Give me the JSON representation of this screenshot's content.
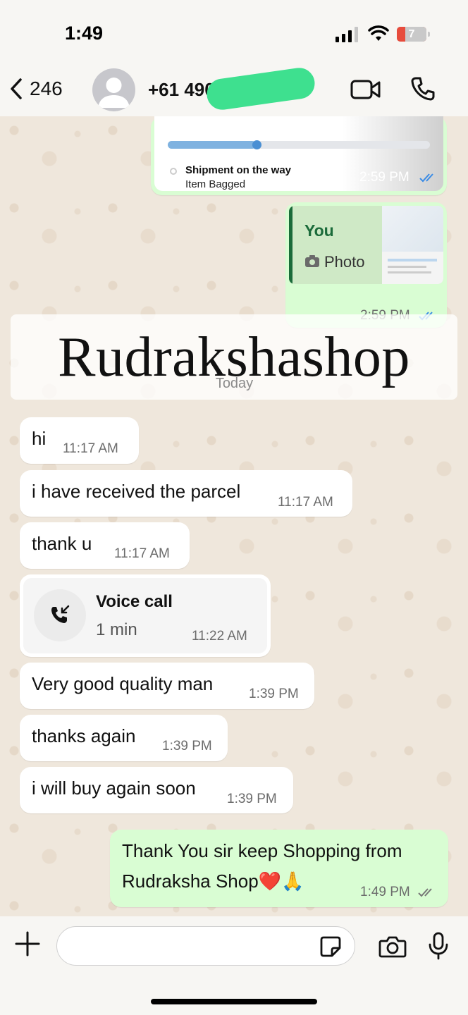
{
  "status_bar": {
    "time": "1:49",
    "battery": "7"
  },
  "header": {
    "back_count": "246",
    "contact": "+61 490 1"
  },
  "earlier": {
    "shipment_status": "Shipment on the way",
    "shipment_sub": "Item Bagged",
    "shipment_time": "2:59 PM",
    "reply_author": "You",
    "reply_type": "Photo",
    "photo_msg_time": "2:59 PM"
  },
  "watermark": "Rudrakshashop",
  "date_divider": "Today",
  "messages": [
    {
      "text": "hi",
      "time": "11:17 AM"
    },
    {
      "text": "i have received the parcel",
      "time": "11:17 AM"
    },
    {
      "text": "thank u",
      "time": "11:17 AM"
    },
    {
      "text": "Very good quality man",
      "time": "1:39 PM"
    },
    {
      "text": "thanks again",
      "time": "1:39 PM"
    },
    {
      "text": "i will buy again soon",
      "time": "1:39 PM"
    }
  ],
  "voice_call": {
    "title": "Voice call",
    "duration": "1 min",
    "time": "11:22 AM"
  },
  "outgoing": {
    "line1": "Thank You sir keep Shopping from",
    "line2": "Rudraksha Shop❤️🙏",
    "time": "1:49 PM"
  },
  "input": {
    "placeholder": ""
  },
  "colors": {
    "outgoing_bubble": "#d9fdd3",
    "read_ticks": "#3b8ce6",
    "progress": "#7fb2e0",
    "redaction": "#3ee08f"
  }
}
